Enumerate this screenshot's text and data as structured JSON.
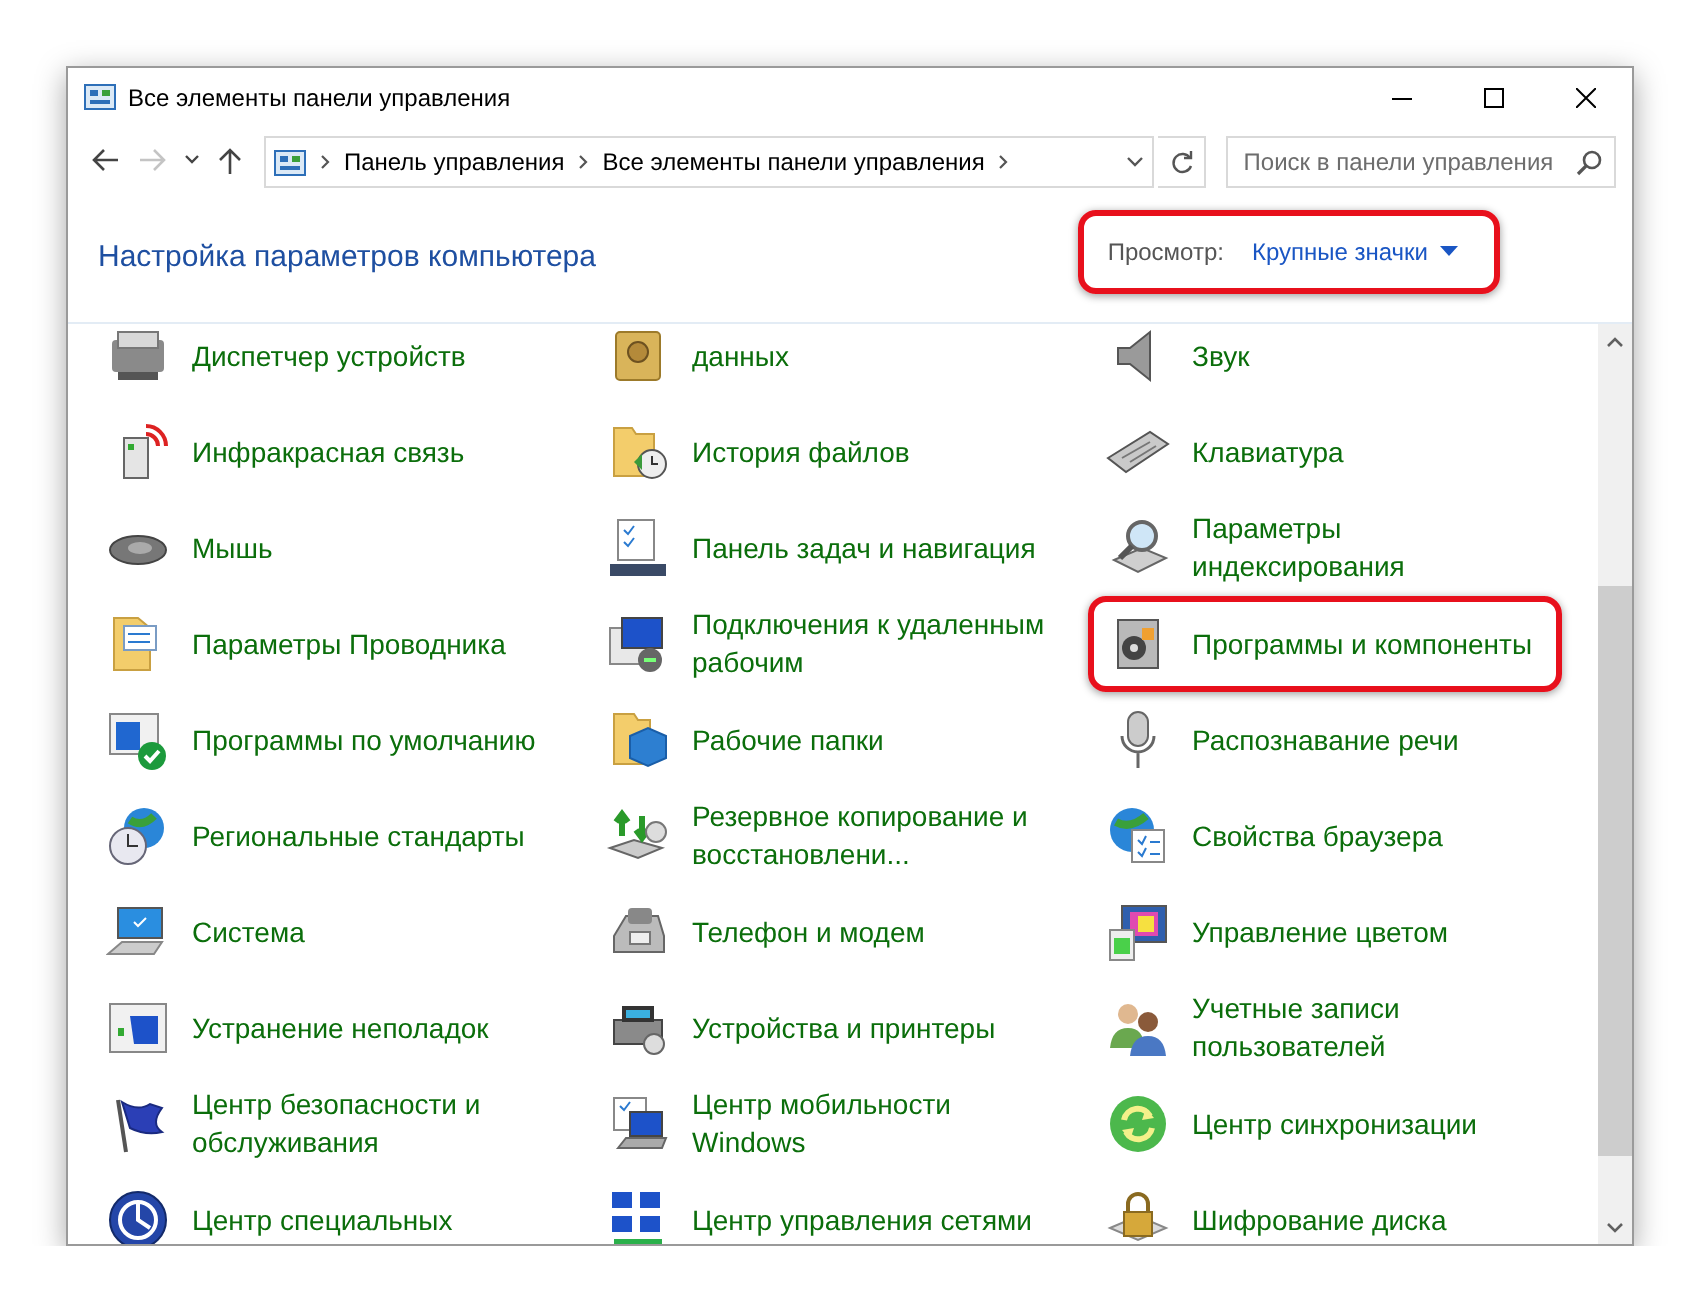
{
  "window": {
    "title": "Все элементы панели управления"
  },
  "nav_buttons": [
    {
      "kind": "back",
      "disabled": false
    },
    {
      "kind": "forward",
      "disabled": true
    },
    {
      "kind": "recent",
      "disabled": false
    },
    {
      "kind": "up",
      "disabled": false
    }
  ],
  "address": {
    "breadcrumbs": [
      "Панель управления",
      "Все элементы панели управления"
    ]
  },
  "search": {
    "placeholder": "Поиск в панели управления"
  },
  "header": {
    "title": "Настройка параметров компьютера",
    "view_label": "Просмотр:",
    "view_value": "Крупные значки",
    "highlighted": true
  },
  "items": [
    {
      "label": "Диспетчер устройств",
      "highlighted": false
    },
    {
      "label": "данных",
      "highlighted": false
    },
    {
      "label": "Звук",
      "highlighted": false
    },
    {
      "label": "Инфракрасная связь",
      "highlighted": false
    },
    {
      "label": "История файлов",
      "highlighted": false
    },
    {
      "label": "Клавиатура",
      "highlighted": false
    },
    {
      "label": "Мышь",
      "highlighted": false
    },
    {
      "label": "Панель задач и навигация",
      "highlighted": false
    },
    {
      "label": "Параметры индексирования",
      "highlighted": false
    },
    {
      "label": "Параметры Проводника",
      "highlighted": false
    },
    {
      "label": "Подключения к удаленным рабочим",
      "highlighted": false
    },
    {
      "label": "Программы и компоненты",
      "highlighted": true
    },
    {
      "label": "Программы по умолчанию",
      "highlighted": false
    },
    {
      "label": "Рабочие папки",
      "highlighted": false
    },
    {
      "label": "Распознавание речи",
      "highlighted": false
    },
    {
      "label": "Региональные стандарты",
      "highlighted": false
    },
    {
      "label": "Резервное копирование и восстановлени...",
      "highlighted": false
    },
    {
      "label": "Свойства браузера",
      "highlighted": false
    },
    {
      "label": "Система",
      "highlighted": false
    },
    {
      "label": "Телефон и модем",
      "highlighted": false
    },
    {
      "label": "Управление цветом",
      "highlighted": false
    },
    {
      "label": "Устранение неполадок",
      "highlighted": false
    },
    {
      "label": "Устройства и принтеры",
      "highlighted": false
    },
    {
      "label": "Учетные записи пользователей",
      "highlighted": false
    },
    {
      "label": "Центр безопасности и обслуживания",
      "highlighted": false
    },
    {
      "label": "Центр мобильности Windows",
      "highlighted": false
    },
    {
      "label": "Центр синхронизации",
      "highlighted": false
    },
    {
      "label": "Центр специальных",
      "highlighted": false
    },
    {
      "label": "Центр управления сетями",
      "highlighted": false
    },
    {
      "label": "Шифрование диска",
      "highlighted": false
    }
  ]
}
